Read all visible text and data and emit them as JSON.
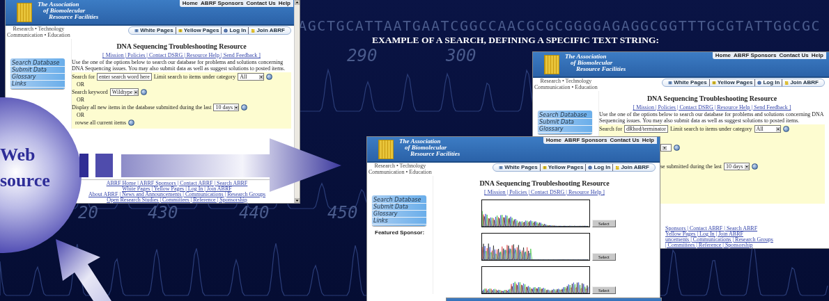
{
  "slide": {
    "title": "EXAMPLE OF A SEARCH, DEFINING A SPECIFIC TEXT STRING:",
    "sequence": "AGCTGCATTAATGAATCGGCCAACGCGCGGGGAGAGGCGGTTTGCGTATTGGCGC",
    "positions": [
      "290",
      "300",
      "20",
      "430",
      "440",
      "450"
    ],
    "badge": [
      "Web",
      "source"
    ]
  },
  "windows": [
    {
      "kind": "search",
      "header": {
        "org_name": [
          "The Association",
          "of Biomolecular",
          "Resource Facilities"
        ],
        "top_links": [
          "Home",
          "ABRF Sponsors",
          "Contact Us",
          "Help"
        ],
        "tagline": [
          "Research • Technology",
          "Communication • Education"
        ],
        "toolbar": [
          "White Pages",
          "Yellow Pages",
          "Log In",
          "Join ABRF"
        ]
      },
      "sidebar": [
        "Search Database",
        "Submit Data",
        "Glossary",
        "Links"
      ],
      "title": "DNA Sequencing Troubleshooting Resource",
      "nav_links": "[ Mission | Policies | Contact DSRG | Resource Help | Send Feedback ]",
      "intro": "Use the one of the options below to search our database for problems and solutions concerning DNA Sequencing issues. You may also submit data as well as suggest solutions to posted items.",
      "form": [
        {
          "kind": "search",
          "label": "Search for",
          "value": "enter search word here",
          "limit_label": "Limit search to items under category",
          "category": "All"
        },
        {
          "kind": "or",
          "text": "OR"
        },
        {
          "kind": "keyword",
          "label": "Search keyword",
          "value": "Wildtype"
        },
        {
          "kind": "or",
          "text": "OR"
        },
        {
          "kind": "recent",
          "label": "Display all new items in the database submitted during the last",
          "period": "10 days"
        },
        {
          "kind": "or",
          "text": "OR"
        },
        {
          "kind": "browse",
          "label": "rowse all current items"
        }
      ],
      "footer_links": [
        "ABRF Home | ABRF Sponsors | Contact ABRF | Search ABRF",
        "White Pages | Yellow Pages | Log In | Join ABRF",
        "About ABRF | News and Announcements | Communications | Research Groups",
        "Open Research Studies | Committees | Reference | Sponsorship"
      ]
    },
    {
      "kind": "search",
      "header": {
        "org_name": [
          "The Association",
          "of Biomolecular",
          "Resource Facilities"
        ],
        "top_links": [
          "Home",
          "ABRF Sponsors",
          "Contact Us",
          "Help"
        ],
        "tagline": [
          "Research • Technology",
          "Communication • Education"
        ],
        "toolbar": [
          "White Pages",
          "Yellow Pages",
          "Log In",
          "Join ABRF"
        ]
      },
      "sidebar": [
        "Search Database",
        "Submit Data",
        "Glossary"
      ],
      "title": "DNA Sequencing Troubleshooting Resource",
      "nav_links": "[ Mission | Policies | Contact DSRG | Resource Help | Send Feedback ]",
      "intro": "Use the one of the options below to search our database for problems and solutions concerning DNA Sequencing issues. You may also submit data as well as suggest solutions to posted items.",
      "form": [
        {
          "kind": "search",
          "label": "Search for",
          "value": "dRhod/terminator",
          "limit_label": "Limit search to items under category",
          "category": "All"
        },
        {
          "kind": "cut_select"
        },
        {
          "kind": "cut_recent",
          "label": "se submitted during the last",
          "period": "10 days"
        }
      ],
      "footer_links": [
        "Sponsors | Contact ABRF | Search ABRF",
        "Yellow Pages | Log In | Join ABRF",
        "uncements | Communications | Research Groups",
        "| Committees | Reference | Sponsorship"
      ]
    },
    {
      "kind": "results",
      "header": {
        "org_name": [
          "The Association",
          "of Biomolecular",
          "Resource Facilities"
        ],
        "top_links": [
          "Home",
          "ABRF Sponsors",
          "Contact Us",
          "Help"
        ],
        "tagline": [
          "Research • Technology",
          "Communication • Education"
        ],
        "toolbar": [
          "White Pages",
          "Yellow Pages",
          "Log In",
          "Join ABRF"
        ]
      },
      "sidebar": [
        "Search Database",
        "Submit Data",
        "Glossary",
        "Links"
      ],
      "sponsor_label": "Featured Sponsor:",
      "title": "DNA Sequencing Troubleshooting Resource",
      "nav_links": "[ Mission | Policies | Contact DSRG | Resource Help ]",
      "results": [
        {
          "button": "Select"
        },
        {
          "button": "Select"
        },
        {
          "button": "Select"
        }
      ]
    }
  ]
}
